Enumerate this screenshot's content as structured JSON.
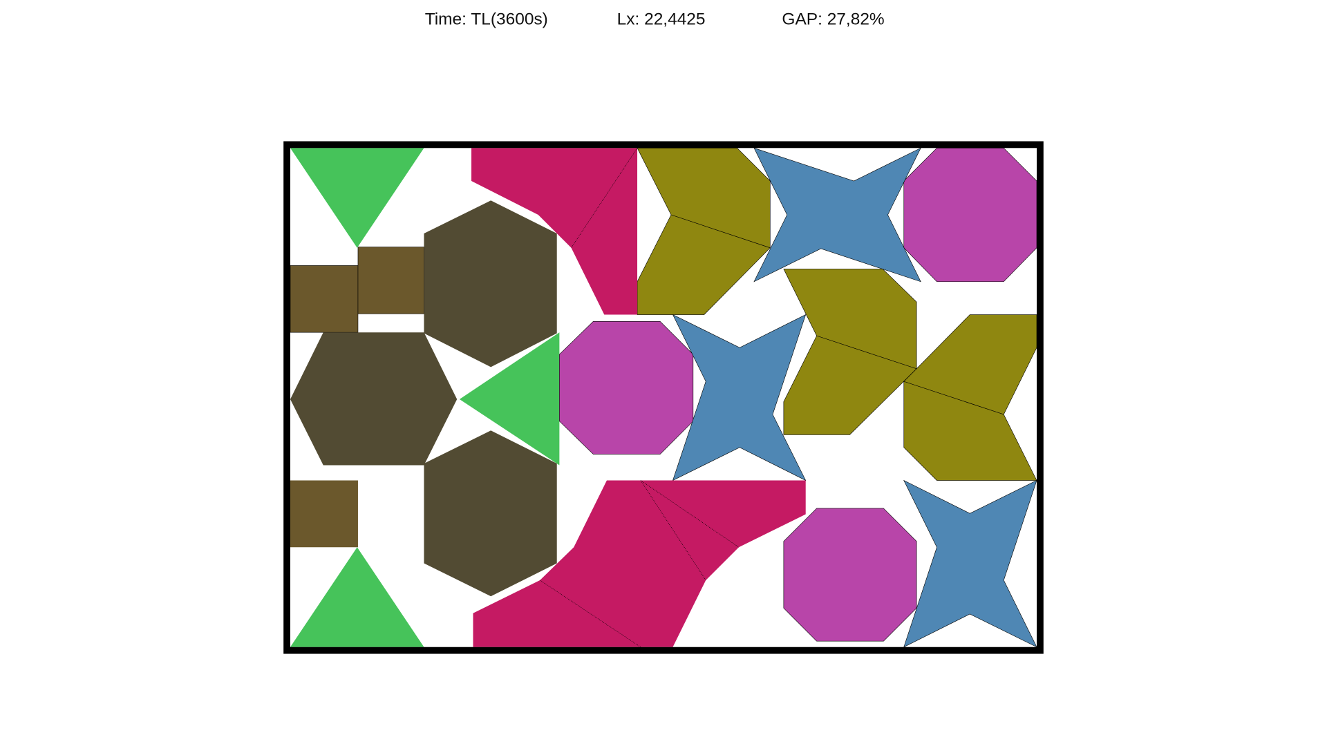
{
  "header": {
    "time": "Time: TL(3600s)",
    "lx": "Lx: 22,4425",
    "gap": "GAP: 27,82%"
  },
  "colors": {
    "green_triangle": "#46c35a",
    "brown_square": "#6b582c",
    "dark_hexagon": "#524b33",
    "magenta_octagon": "#b845a9",
    "blue_star": "#4f87b4",
    "olive_piece": "#8f8710",
    "crimson_piece": "#c51a63",
    "frame": "#000000"
  }
}
